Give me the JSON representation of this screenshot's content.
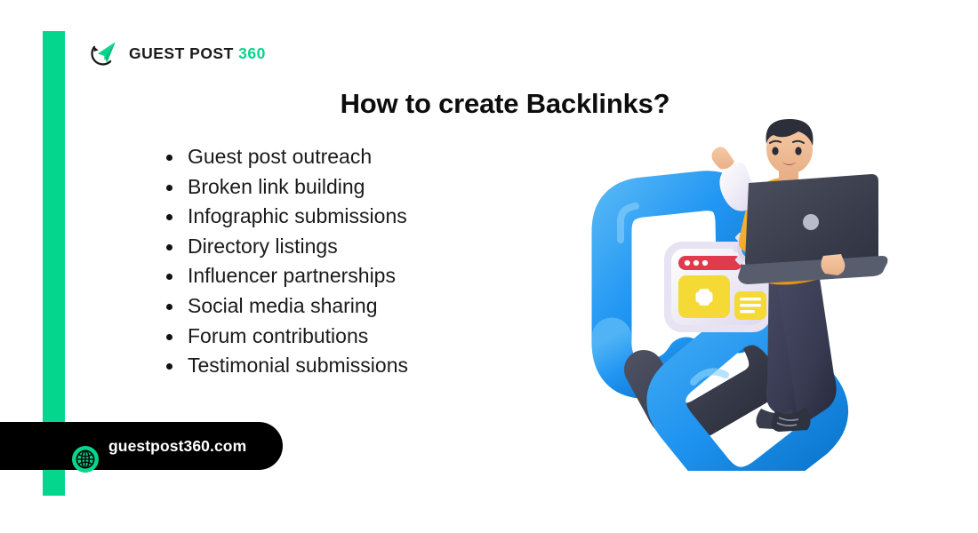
{
  "brand": {
    "logo_icon": "paper-plane-refresh-icon",
    "name": "GUEST POST ",
    "name_suffix": "360",
    "accent_color": "#05d68d",
    "bar_color": "#05d68d"
  },
  "heading": {
    "title": "How to create Backlinks?"
  },
  "list": {
    "items": [
      {
        "label": "Guest post outreach"
      },
      {
        "label": "Broken link building"
      },
      {
        "label": "Infographic submissions"
      },
      {
        "label": "Directory listings"
      },
      {
        "label": "Influencer partnerships"
      },
      {
        "label": "Social media sharing"
      },
      {
        "label": "Forum contributions"
      },
      {
        "label": "Testimonial submissions"
      }
    ]
  },
  "footer": {
    "globe_icon": "globe-icon",
    "url": "guestpost360.com",
    "badge_color": "#000000",
    "text_color": "#ffffff"
  },
  "illustration": {
    "name": "backlink-chain-person-illustration",
    "elements": [
      "chain-link-blue-top",
      "chain-link-dark-middle",
      "chain-link-blue-bottom",
      "browser-card-widget",
      "gear-icon",
      "person-with-laptop"
    ],
    "colors": {
      "chain_blue": "#2196f3",
      "chain_dark": "#3f4451",
      "shirt": "#f5a623",
      "pants": "#393b52",
      "laptop": "#3b3f4d",
      "card_titlebar": "#e03a4e",
      "card_panel": "#f5d934",
      "gear": "#2196f3"
    }
  }
}
